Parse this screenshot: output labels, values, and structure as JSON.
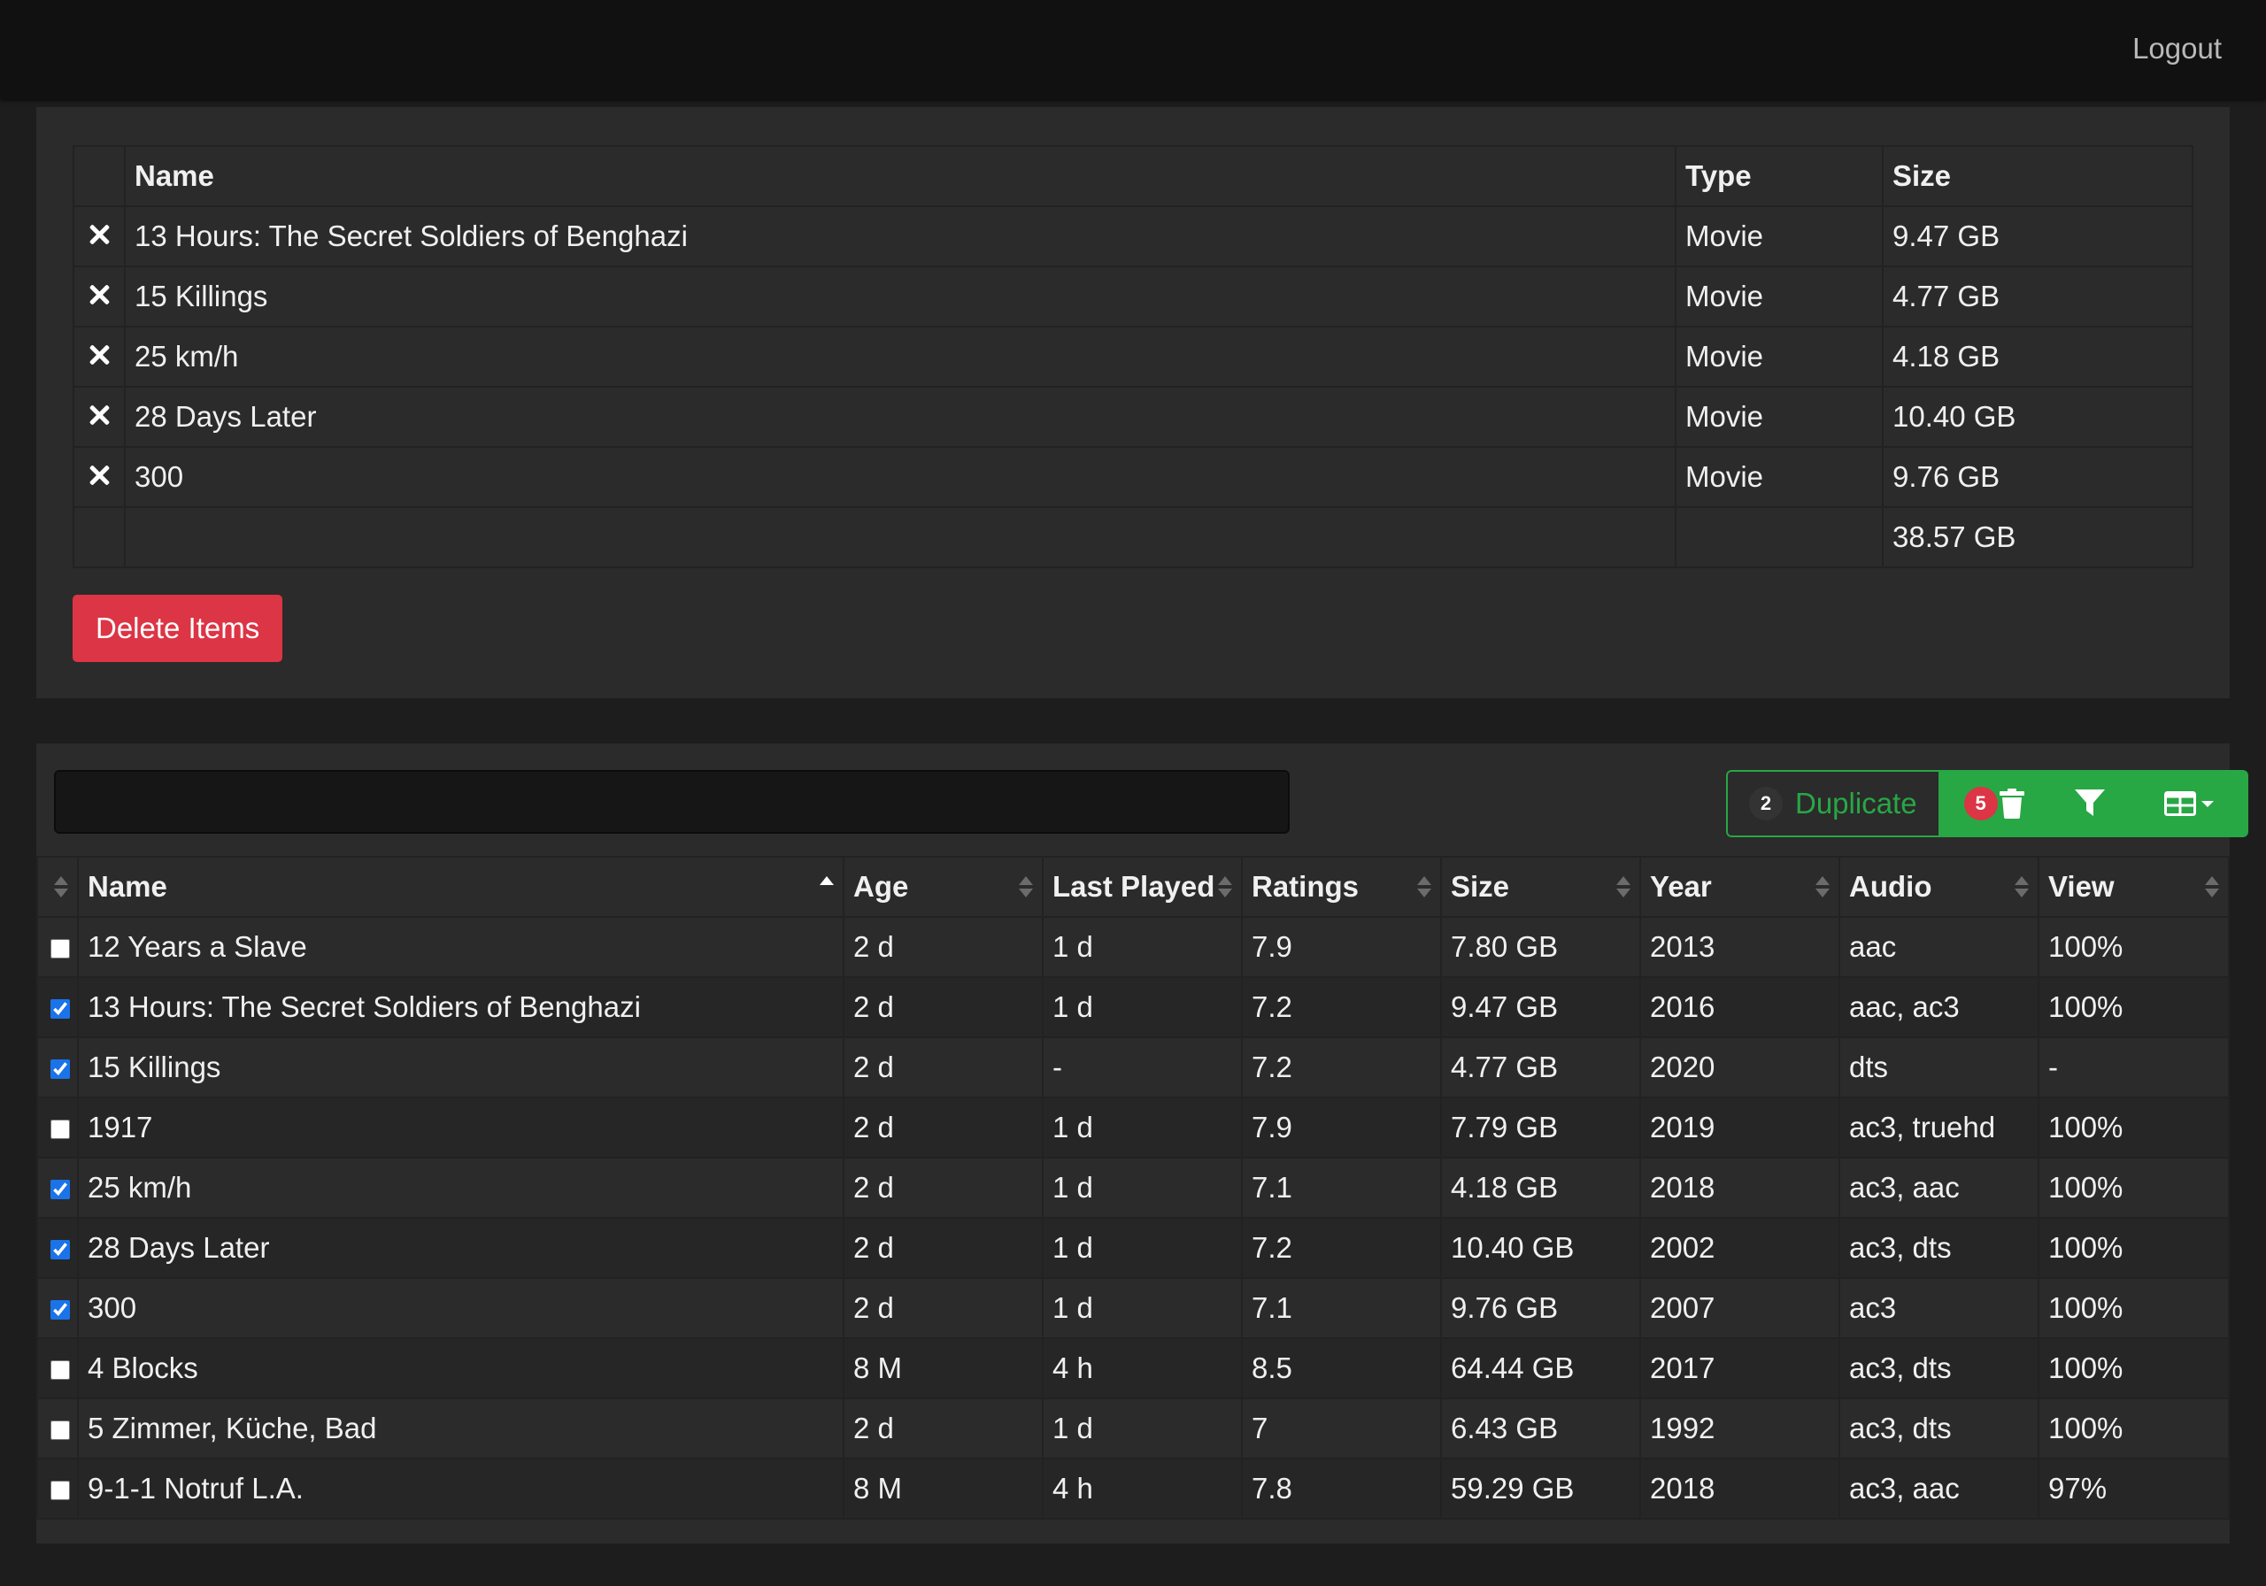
{
  "header": {
    "logout": "Logout"
  },
  "selection": {
    "columns": {
      "name": "Name",
      "type": "Type",
      "size": "Size"
    },
    "items": [
      {
        "name": "13 Hours: The Secret Soldiers of Benghazi",
        "type": "Movie",
        "size": "9.47 GB"
      },
      {
        "name": "15 Killings",
        "type": "Movie",
        "size": "4.77 GB"
      },
      {
        "name": "25 km/h",
        "type": "Movie",
        "size": "4.18 GB"
      },
      {
        "name": "28 Days Later",
        "type": "Movie",
        "size": "10.40 GB"
      },
      {
        "name": "300",
        "type": "Movie",
        "size": "9.76 GB"
      }
    ],
    "total_size": "38.57 GB",
    "delete_label": "Delete Items"
  },
  "toolbar": {
    "search_value": "",
    "duplicate_count": "2",
    "duplicate_label": "Duplicate",
    "delete_count": "5",
    "accent_color": "#28a745",
    "danger_color": "#dc3545"
  },
  "library": {
    "columns": {
      "name": "Name",
      "age": "Age",
      "last_played": "Last Played",
      "ratings": "Ratings",
      "size": "Size",
      "year": "Year",
      "audio": "Audio",
      "view": "View"
    },
    "rows": [
      {
        "checked": false,
        "name": "12 Years a Slave",
        "age": "2 d",
        "last_played": "1 d",
        "ratings": "7.9",
        "size": "7.80 GB",
        "year": "2013",
        "audio": "aac",
        "view": "100%"
      },
      {
        "checked": true,
        "name": "13 Hours: The Secret Soldiers of Benghazi",
        "age": "2 d",
        "last_played": "1 d",
        "ratings": "7.2",
        "size": "9.47 GB",
        "year": "2016",
        "audio": "aac, ac3",
        "view": "100%"
      },
      {
        "checked": true,
        "name": "15 Killings",
        "age": "2 d",
        "last_played": "-",
        "ratings": "7.2",
        "size": "4.77 GB",
        "year": "2020",
        "audio": "dts",
        "view": "-"
      },
      {
        "checked": false,
        "name": "1917",
        "age": "2 d",
        "last_played": "1 d",
        "ratings": "7.9",
        "size": "7.79 GB",
        "year": "2019",
        "audio": "ac3, truehd",
        "view": "100%"
      },
      {
        "checked": true,
        "name": "25 km/h",
        "age": "2 d",
        "last_played": "1 d",
        "ratings": "7.1",
        "size": "4.18 GB",
        "year": "2018",
        "audio": "ac3, aac",
        "view": "100%"
      },
      {
        "checked": true,
        "name": "28 Days Later",
        "age": "2 d",
        "last_played": "1 d",
        "ratings": "7.2",
        "size": "10.40 GB",
        "year": "2002",
        "audio": "ac3, dts",
        "view": "100%"
      },
      {
        "checked": true,
        "name": "300",
        "age": "2 d",
        "last_played": "1 d",
        "ratings": "7.1",
        "size": "9.76 GB",
        "year": "2007",
        "audio": "ac3",
        "view": "100%"
      },
      {
        "checked": false,
        "name": "4 Blocks",
        "age": "8 M",
        "last_played": "4 h",
        "ratings": "8.5",
        "size": "64.44 GB",
        "year": "2017",
        "audio": "ac3, dts",
        "view": "100%"
      },
      {
        "checked": false,
        "name": "5 Zimmer, Küche, Bad",
        "age": "2 d",
        "last_played": "1 d",
        "ratings": "7",
        "size": "6.43 GB",
        "year": "1992",
        "audio": "ac3, dts",
        "view": "100%"
      },
      {
        "checked": false,
        "name": "9-1-1 Notruf L.A.",
        "age": "8 M",
        "last_played": "4 h",
        "ratings": "7.8",
        "size": "59.29 GB",
        "year": "2018",
        "audio": "ac3, aac",
        "view": "97%"
      }
    ]
  }
}
